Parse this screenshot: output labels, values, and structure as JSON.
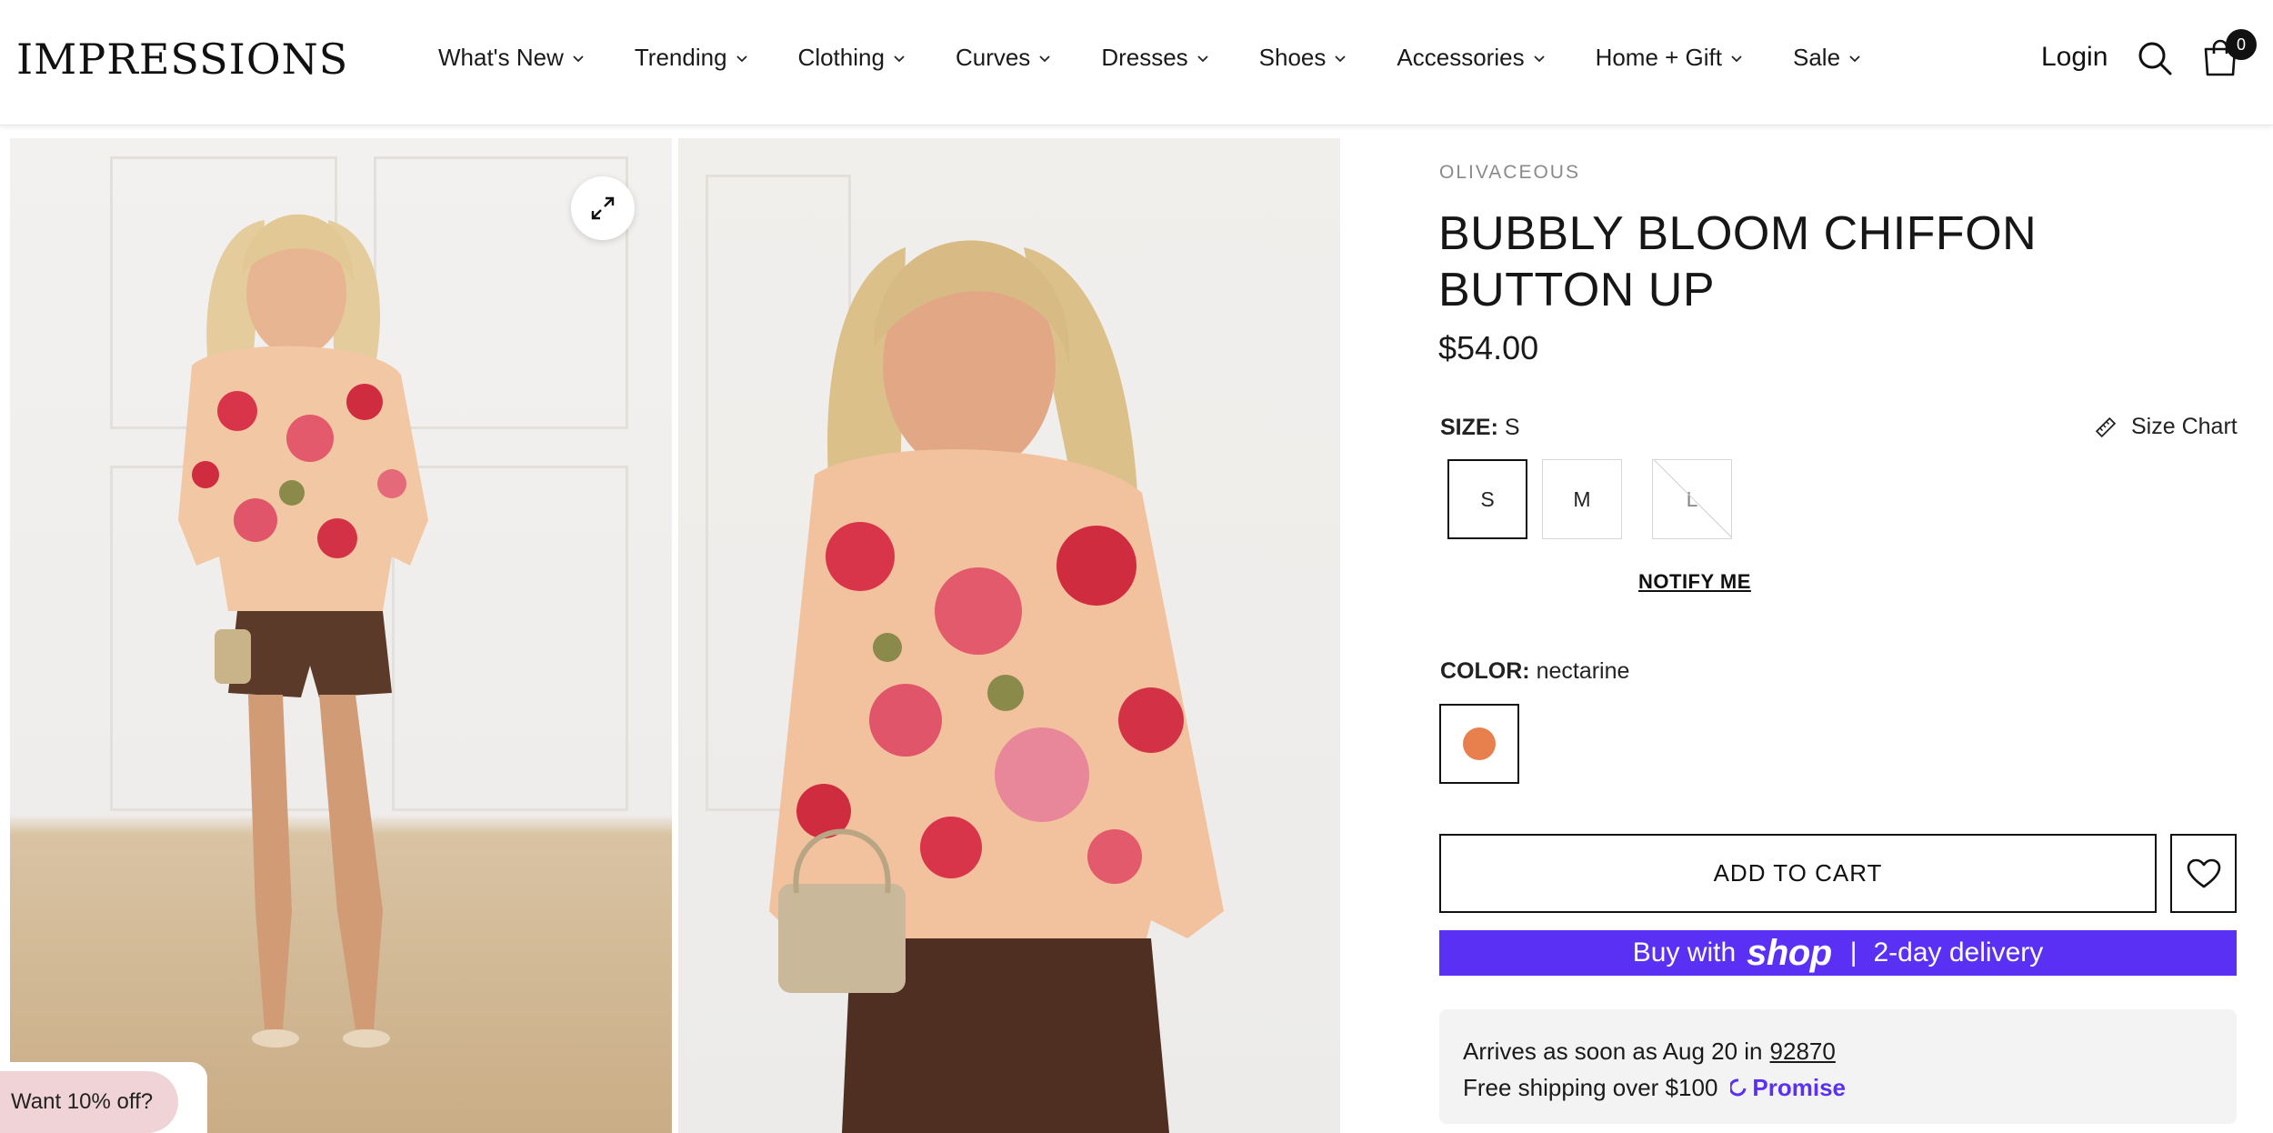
{
  "header": {
    "logo": "IMPRESSIONS",
    "nav": [
      {
        "label": "What's New"
      },
      {
        "label": "Trending"
      },
      {
        "label": "Clothing"
      },
      {
        "label": "Curves"
      },
      {
        "label": "Dresses"
      },
      {
        "label": "Shoes"
      },
      {
        "label": "Accessories"
      },
      {
        "label": "Home + Gift"
      },
      {
        "label": "Sale"
      }
    ],
    "login": "Login",
    "cart_count": "0",
    "icons": {
      "search": "search-icon",
      "cart": "shopping-bag-icon",
      "chevron": "chevron-down-icon"
    }
  },
  "gallery": {
    "expand_icon": "expand-icon",
    "promo": "Want 10% off?"
  },
  "product": {
    "vendor": "OLIVACEOUS",
    "title": "BUBBLY BLOOM CHIFFON BUTTON UP",
    "price": "$54.00",
    "size_label": "SIZE:",
    "size_value": "S",
    "size_chart": "Size Chart",
    "sizes": [
      {
        "label": "S",
        "state": "selected"
      },
      {
        "label": "M",
        "state": "available"
      },
      {
        "label": "L",
        "state": "sold-out"
      }
    ],
    "notify": "NOTIFY ME",
    "color_label": "COLOR:",
    "color_value": "nectarine",
    "color_swatch": "#e8804e",
    "add_to_cart": "ADD TO CART",
    "shop_pay": {
      "prefix": "Buy with",
      "brand": "shop",
      "divider": "|",
      "suffix": "2-day delivery",
      "color": "#5a31f4"
    },
    "delivery": {
      "arrives_prefix": "Arrives as soon as Aug 20 in",
      "zip": "92870",
      "shipping": "Free shipping over $100",
      "promise": "Promise"
    }
  }
}
